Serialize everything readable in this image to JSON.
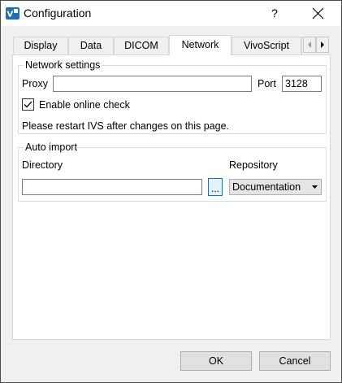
{
  "window": {
    "title": "Configuration",
    "help_label": "?"
  },
  "tabs": [
    {
      "label": "Display"
    },
    {
      "label": "Data"
    },
    {
      "label": "DICOM"
    },
    {
      "label": "Network"
    },
    {
      "label": "VivoScript"
    }
  ],
  "active_tab": "Network",
  "network_settings": {
    "title": "Network settings",
    "proxy_label": "Proxy",
    "proxy_value": "",
    "port_label": "Port",
    "port_value": "3128",
    "online_check_label": "Enable online check",
    "online_check_checked": true,
    "restart_note": "Please restart IVS after changes on this page."
  },
  "auto_import": {
    "title": "Auto import",
    "directory_label": "Directory",
    "directory_value": "",
    "browse_label": "...",
    "repository_label": "Repository",
    "repository_value": "Documentation"
  },
  "footer": {
    "ok_label": "OK",
    "cancel_label": "Cancel"
  },
  "colors": {
    "accent": "#0078d7",
    "title_bar": "#ffffff",
    "dialog_bg": "#f0f0f0"
  }
}
